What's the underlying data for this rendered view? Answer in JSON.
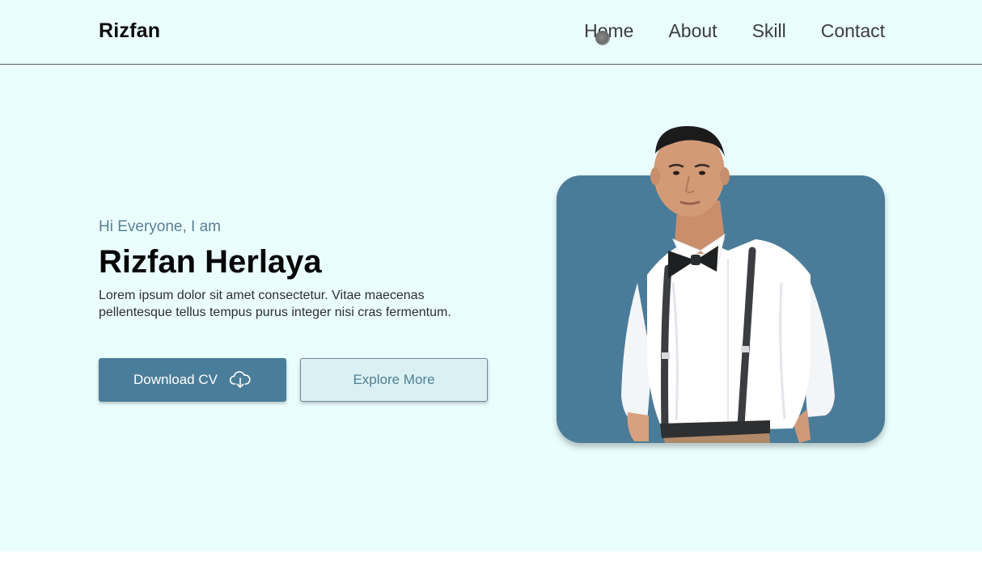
{
  "navbar": {
    "logo": "Rizfan",
    "links": [
      {
        "label": "Home"
      },
      {
        "label": "About"
      },
      {
        "label": "Skill"
      },
      {
        "label": "Contact"
      }
    ]
  },
  "hero": {
    "greeting": "Hi Everyone, I am",
    "name": "Rizfan Herlaya",
    "description": "Lorem ipsum dolor sit amet consectetur. Vitae maecenas pellentesque tellus tempus purus integer nisi cras fermentum.",
    "primary_button": {
      "label": "Download CV",
      "icon": "cloud-download-icon"
    },
    "secondary_button": {
      "label": "Explore More"
    }
  },
  "colors": {
    "background": "#ebfefe",
    "accent": "#4a7d99",
    "secondary_button_bg": "#daf0f3",
    "greeting_text": "#5a7f92"
  }
}
